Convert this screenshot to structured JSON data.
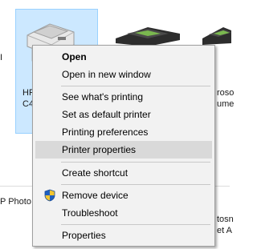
{
  "background": {
    "selected_printer_label_fragments": [
      "HP",
      "C4"
    ],
    "left_fragment": "I",
    "right_labels_top": [
      "roso",
      "ume"
    ],
    "bottom_left_label": "P Photo",
    "right_labels_bottom": [
      "tosn",
      "et A"
    ]
  },
  "menu": {
    "items": [
      {
        "label": "Open",
        "bold": true
      },
      {
        "label": "Open in new window"
      },
      {
        "label": "See what's printing"
      },
      {
        "label": "Set as default printer"
      },
      {
        "label": "Printing preferences"
      },
      {
        "label": "Printer properties",
        "hover": true
      },
      {
        "label": "Create shortcut"
      },
      {
        "label": "Remove device",
        "icon": "shield-icon"
      },
      {
        "label": "Troubleshoot"
      },
      {
        "label": "Properties"
      }
    ]
  },
  "colors": {
    "selection_fill": "#cce8ff",
    "menu_bg": "#f2f2f2",
    "menu_hover": "#d9d9d9"
  }
}
